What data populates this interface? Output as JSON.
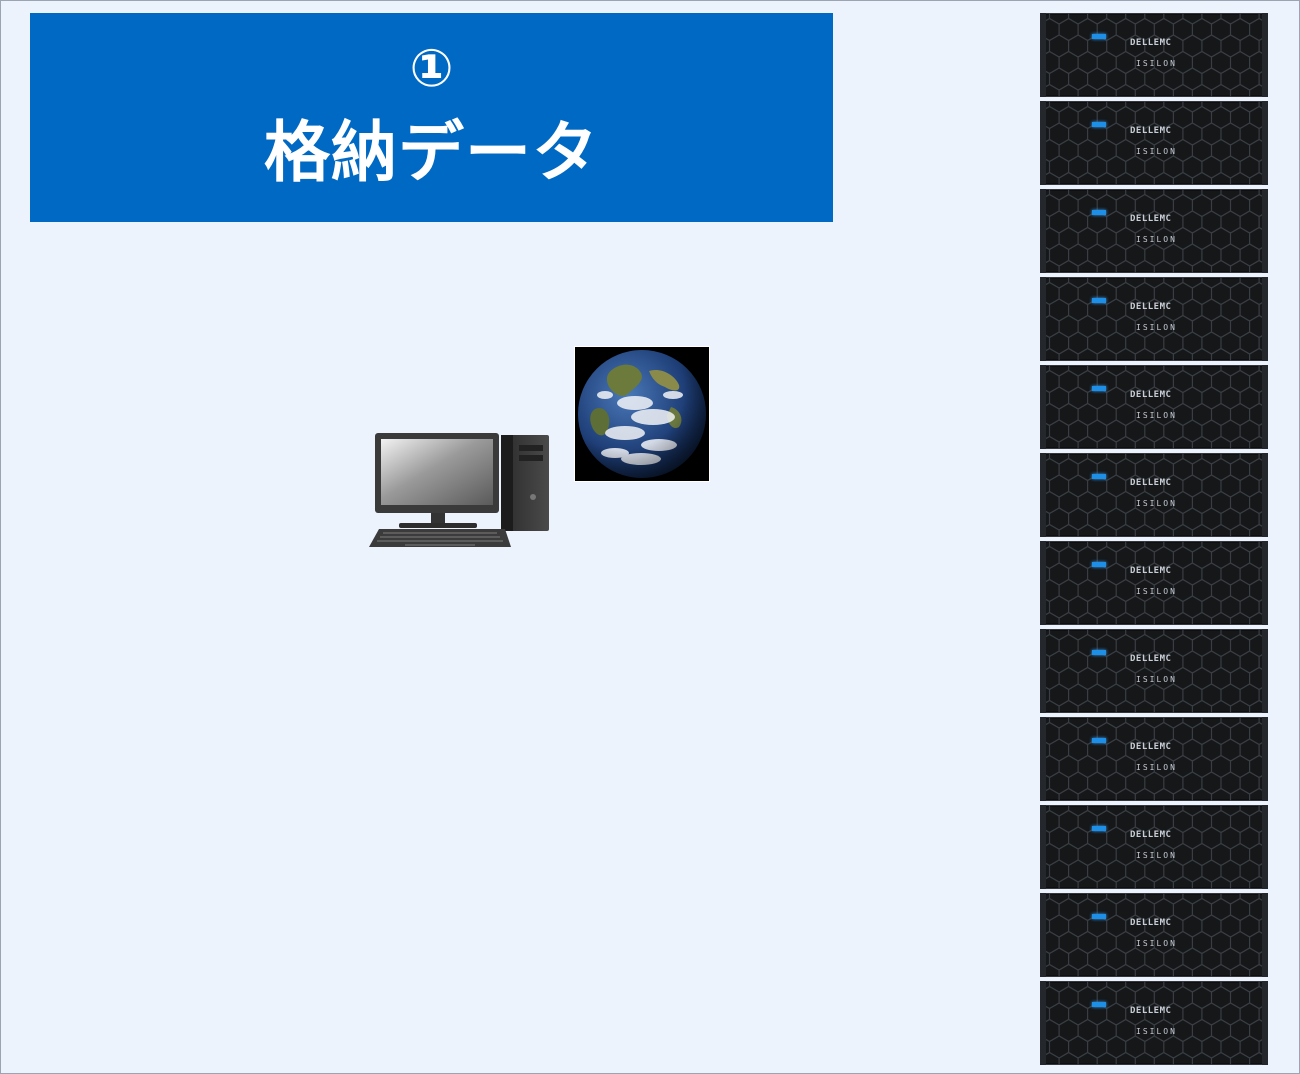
{
  "header": {
    "step_number": "①",
    "step_title": "格納データ",
    "background_color": "#0069c4"
  },
  "desktop_computer": {
    "icon": "desktop-computer-icon"
  },
  "earth_image": {
    "icon": "earth-globe-icon"
  },
  "storage_rack": {
    "icon": "storage-server-icon",
    "node_count": 12,
    "nodes": [
      {
        "brand": "DELLEMC",
        "model": "ISILON"
      },
      {
        "brand": "DELLEMC",
        "model": "ISILON"
      },
      {
        "brand": "DELLEMC",
        "model": "ISILON"
      },
      {
        "brand": "DELLEMC",
        "model": "ISILON"
      },
      {
        "brand": "DELLEMC",
        "model": "ISILON"
      },
      {
        "brand": "DELLEMC",
        "model": "ISILON"
      },
      {
        "brand": "DELLEMC",
        "model": "ISILON"
      },
      {
        "brand": "DELLEMC",
        "model": "ISILON"
      },
      {
        "brand": "DELLEMC",
        "model": "ISILON"
      },
      {
        "brand": "DELLEMC",
        "model": "ISILON"
      },
      {
        "brand": "DELLEMC",
        "model": "ISILON"
      },
      {
        "brand": "DELLEMC",
        "model": "ISILON"
      }
    ]
  }
}
